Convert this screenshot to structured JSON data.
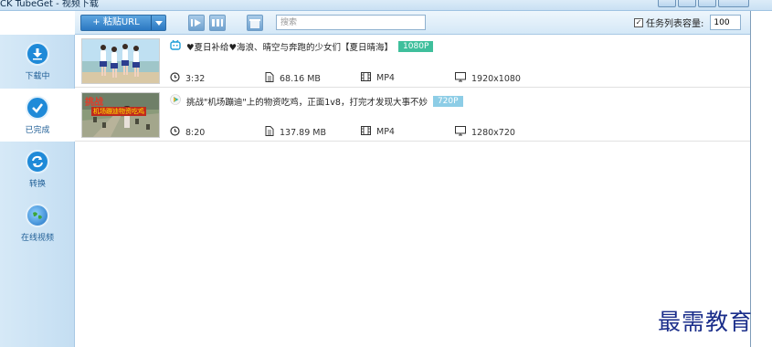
{
  "window": {
    "title": "CK TubeGet - 视频下载"
  },
  "toolbar": {
    "paste_label": "+ 粘贴URL",
    "search_placeholder": "搜索",
    "capacity_label": "任务列表容量:",
    "capacity_value": "100",
    "capacity_checked": "✓"
  },
  "sidebar": {
    "items": [
      {
        "label": "下载中",
        "icon": "download-icon",
        "active": false
      },
      {
        "label": "已完成",
        "icon": "check-icon",
        "active": true
      },
      {
        "label": "转换",
        "icon": "convert-icon",
        "active": false
      },
      {
        "label": "在线视频",
        "icon": "globe-icon",
        "active": false
      }
    ]
  },
  "downloads": [
    {
      "title": "♥夏日补给♥海浪、晴空与奔跑的少女们【夏日晴海】",
      "source_icon": "bilibili-icon",
      "resolution_badge": "1080P",
      "badge_color": "#3fbf9c",
      "duration": "3:32",
      "size": "68.16 MB",
      "format": "MP4",
      "dimensions": "1920x1080"
    },
    {
      "title": "挑战\"机场蹦迪\"上的物资吃鸡，正面1v8，打完才发现大事不妙",
      "source_icon": "play-icon",
      "resolution_badge": "720P",
      "badge_color": "#8dcde6",
      "duration": "8:20",
      "size": "137.89 MB",
      "format": "MP4",
      "dimensions": "1280x720"
    }
  ],
  "thumb2_text": [
    "挑战",
    "机场蹦迪物资吃鸡"
  ],
  "watermark": "最需教育"
}
